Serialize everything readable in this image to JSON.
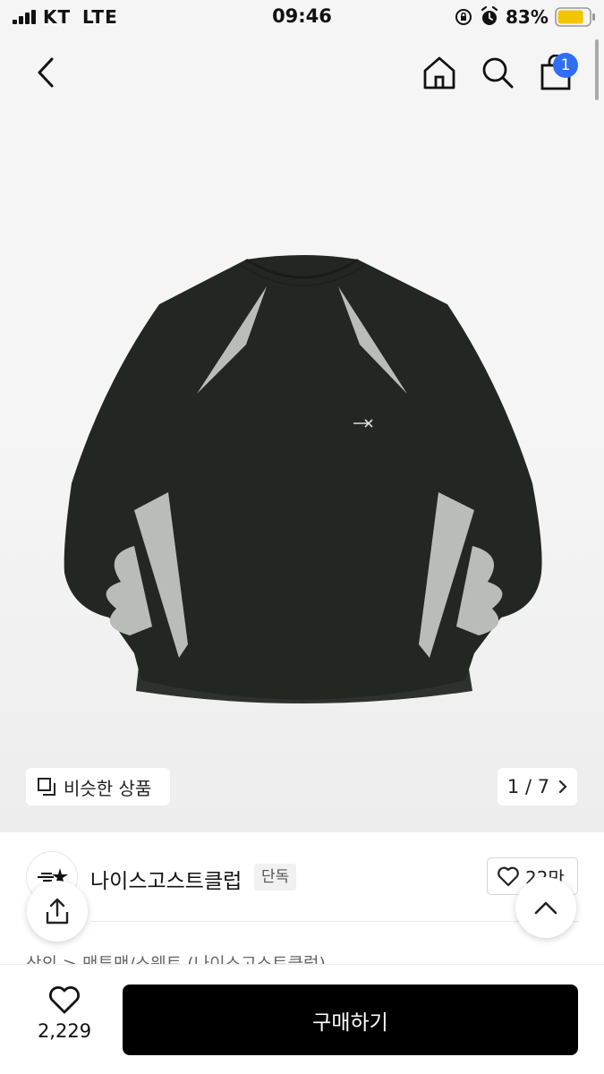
{
  "status_bar": {
    "carrier": "KT",
    "network": "LTE",
    "time": "09:46",
    "battery_percent": "83%",
    "battery_level": 0.83,
    "icons": [
      "signal-icon",
      "orientation-lock-icon",
      "alarm-icon",
      "battery-icon"
    ]
  },
  "header": {
    "icons": [
      "back-chevron-icon",
      "home-icon",
      "search-icon",
      "shopping-bag-icon"
    ],
    "cart_count": "1"
  },
  "gallery": {
    "similar_label": "비슷한 상품",
    "pager": "1 / 7",
    "colors": {
      "body": "#232723",
      "panel": "#b9bdb7"
    }
  },
  "product": {
    "brand_name": "나이스고스트클럽",
    "exclusive_badge": "단독",
    "like_count": "22만",
    "category_path": "상의  >  맨투맨/스웨트  (나이스고스트클럽)"
  },
  "bottom_bar": {
    "wish_count": "2,229",
    "buy_label": "구매하기"
  },
  "colors": {
    "badge": "#2f6ff5",
    "buy_button": "#000000",
    "background": "#f5f5f5"
  }
}
